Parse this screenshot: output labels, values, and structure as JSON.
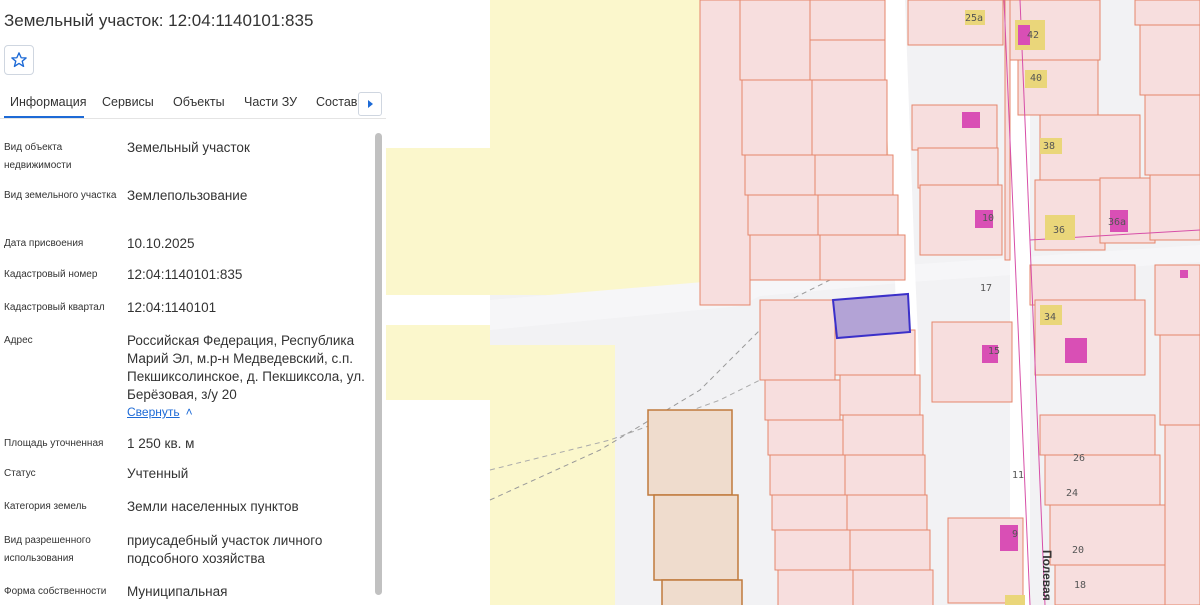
{
  "panel": {
    "title": "Земельный участок: 12:04:1140101:835",
    "favorite_icon": "star-outline-icon",
    "tabs": [
      {
        "label": "Информация",
        "active": true
      },
      {
        "label": "Сервисы"
      },
      {
        "label": "Объекты"
      },
      {
        "label": "Части ЗУ"
      },
      {
        "label": "Состав"
      }
    ],
    "next_tab_icon": "caret-right-icon",
    "properties": [
      {
        "label": "Вид объекта недвижимости",
        "value": "Земельный участок"
      },
      {
        "label": "Вид земельного участка",
        "value": "Землепользование"
      },
      {
        "label": "Дата присвоения",
        "value": "10.10.2025"
      },
      {
        "label": "Кадастровый номер",
        "value": "12:04:1140101:835"
      },
      {
        "label": "Кадастровый квартал",
        "value": "12:04:1140101"
      },
      {
        "label": "Адрес",
        "value": "Российская Федерация, Республика Марий Эл, м.р-н Медведевский, с.п. Пекшиксолинское, д. Пекшиксола, ул. Берёзовая, з/у 20"
      },
      {
        "label": "Площадь уточненная",
        "value": "1 250 кв. м"
      },
      {
        "label": "Статус",
        "value": "Учтенный"
      },
      {
        "label": "Категория земель",
        "value": "Земли населенных пунктов"
      },
      {
        "label": "Вид разрешенного использования",
        "value": "приусадебный участок личного подсобного хозяйства"
      },
      {
        "label": "Форма собственности",
        "value": "Муниципальная"
      }
    ],
    "collapse_link": "Свернуть"
  },
  "map": {
    "street_label": "Полевая",
    "lot_numbers": [
      "25а",
      "42",
      "40",
      "38",
      "10",
      "36",
      "36а",
      "17",
      "34",
      "15",
      "26",
      "11",
      "24",
      "9",
      "20",
      "18"
    ],
    "colors": {
      "selected_fill": "#b3a3d6",
      "selected_stroke": "#3b30c9",
      "parcel_stroke": "#e5866b",
      "parcel_fill": "#f7dede",
      "zone_yellow": "#fbf6c8",
      "zone_beige": "#f0dccb",
      "building_pink": "#d94fb5",
      "building_yellow": "#ead67a"
    }
  }
}
